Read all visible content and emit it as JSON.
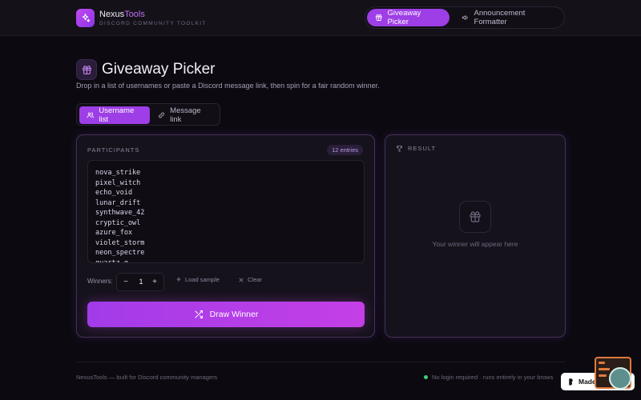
{
  "header": {
    "brand_main": "Nexus",
    "brand_accent": "Tools",
    "brand_subtitle": "DISCORD COMMUNITY TOOLKIT",
    "nav": [
      {
        "label": "Giveaway Picker",
        "icon": "gift-icon",
        "active": true
      },
      {
        "label": "Announcement Formatter",
        "icon": "megaphone-icon",
        "active": false
      }
    ]
  },
  "page": {
    "title": "Giveaway Picker",
    "subtitle": "Drop in a list of usernames or paste a Discord message link, then spin for a fair random winner.",
    "mode_tabs": [
      {
        "label": "Username list",
        "icon": "users-icon",
        "active": true
      },
      {
        "label": "Message link",
        "icon": "link-icon",
        "active": false
      }
    ]
  },
  "participants": {
    "label": "PARTICIPANTS",
    "count_badge": "12 entries",
    "entries": [
      "nova_strike",
      "pixel_witch",
      "echo_void",
      "lunar_drift",
      "synthwave_42",
      "cryptic_owl",
      "azure_fox",
      "violet_storm",
      "neon_spectre",
      "quartz_g"
    ],
    "winners_label": "Winners:",
    "winners_value": "1",
    "minus": "−",
    "plus": "+",
    "load_sample": "Load sample",
    "clear": "Clear",
    "draw_button": "Draw Winner"
  },
  "result": {
    "label": "RESULT",
    "empty_text": "Your winner will appear here"
  },
  "footer": {
    "left": "NexusTools — built for Discord community managers",
    "right": "No login required · runs entirely in your brows"
  },
  "badge": {
    "text": "Made in B"
  },
  "colors": {
    "accent": "#9d3ee6",
    "background": "#0c0a10",
    "card_border": "#43305e"
  }
}
